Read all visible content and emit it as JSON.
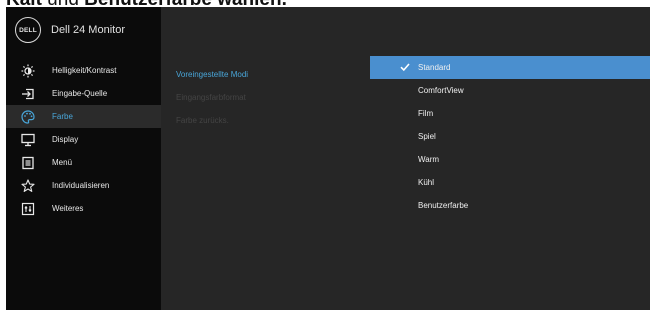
{
  "caption": {
    "prefix_bold": "Kalt",
    "middle": " und ",
    "suffix_bold": "Benutzerfarbe wählen."
  },
  "brand": {
    "logo_text": "DELL",
    "model": "Dell 24 Monitor"
  },
  "nav": {
    "items": [
      {
        "label": "Helligkeit/Kontrast",
        "icon": "brightness-icon"
      },
      {
        "label": "Eingabe-Quelle",
        "icon": "input-source-icon"
      },
      {
        "label": "Farbe",
        "icon": "palette-icon"
      },
      {
        "label": "Display",
        "icon": "display-icon"
      },
      {
        "label": "Menü",
        "icon": "menu-icon"
      },
      {
        "label": "Individualisieren",
        "icon": "star-icon"
      },
      {
        "label": "Weiteres",
        "icon": "others-icon"
      }
    ],
    "active": "Farbe"
  },
  "submenu": {
    "items": [
      {
        "label": "Voreingestellte Modi",
        "state": "active"
      },
      {
        "label": "Eingangsfarbformat",
        "state": "disabled"
      },
      {
        "label": "Farbe zurücks.",
        "state": "disabled"
      }
    ]
  },
  "options": {
    "items": [
      "Standard",
      "ComfortView",
      "Film",
      "Spiel",
      "Warm",
      "Kühl",
      "Benutzerfarbe"
    ],
    "selected": "Standard"
  },
  "colors": {
    "accent": "#49a6d9",
    "selection": "#4a8fcf",
    "sidebar": "#0b0b0b",
    "panel": "#262626"
  }
}
